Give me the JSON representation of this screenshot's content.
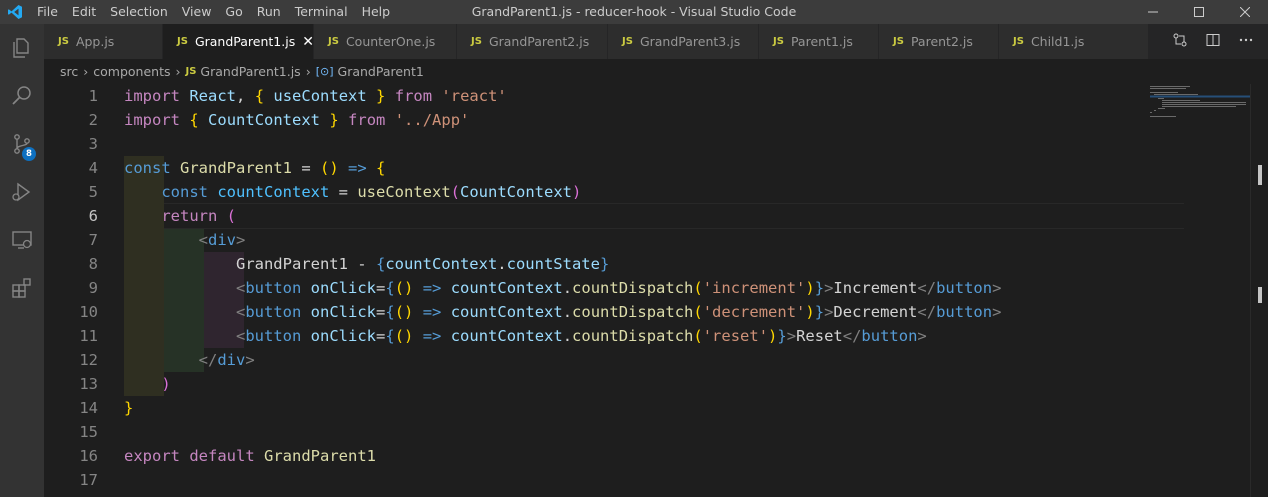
{
  "titlebar": {
    "title": "GrandParent1.js - reducer-hook - Visual Studio Code",
    "menu": [
      "File",
      "Edit",
      "Selection",
      "View",
      "Go",
      "Run",
      "Terminal",
      "Help"
    ]
  },
  "activity": {
    "icons": [
      "explorer-icon",
      "search-icon",
      "source-control-icon",
      "run-debug-icon",
      "remote-explorer-icon",
      "extensions-icon"
    ],
    "scm_badge": "8"
  },
  "tabs": [
    {
      "badge": "JS",
      "label": "App.js",
      "active": false
    },
    {
      "badge": "JS",
      "label": "GrandParent1.js",
      "active": true
    },
    {
      "badge": "JS",
      "label": "CounterOne.js",
      "active": false
    },
    {
      "badge": "JS",
      "label": "GrandParent2.js",
      "active": false
    },
    {
      "badge": "JS",
      "label": "GrandParent3.js",
      "active": false
    },
    {
      "badge": "JS",
      "label": "Parent1.js",
      "active": false
    },
    {
      "badge": "JS",
      "label": "Parent2.js",
      "active": false
    },
    {
      "badge": "JS",
      "label": "Child1.js",
      "active": false
    }
  ],
  "breadcrumb": {
    "folder1": "src",
    "folder2": "components",
    "file_badge": "JS",
    "file": "GrandParent1.js",
    "symbol": "GrandParent1"
  },
  "editor": {
    "line_numbers": [
      "1",
      "2",
      "3",
      "4",
      "5",
      "6",
      "7",
      "8",
      "9",
      "10",
      "11",
      "12",
      "13",
      "14",
      "15",
      "16",
      "17"
    ],
    "current_line": "6",
    "lines": [
      "import React, { useContext } from 'react'",
      "import { CountContext } from '../App'",
      "",
      "const GrandParent1 = () => {",
      "    const countContext = useContext(CountContext)",
      "    return (",
      "        <div>",
      "            GrandParent1 - {countContext.countState}",
      "            <button onClick={() => countContext.countDispatch('increment')}>Increment</button>",
      "            <button onClick={() => countContext.countDispatch('decrement')}>Decrement</button>",
      "            <button onClick={() => countContext.countDispatch('reset')}>Reset</button>",
      "        </div>",
      "    )",
      "}",
      "",
      "export default GrandParent1",
      ""
    ]
  },
  "colors": {
    "accent": "#0e70c0",
    "js_badge": "#cbcb41",
    "keyword": "#569cd6",
    "control": "#c586c0",
    "string": "#ce9178",
    "function": "#dcdcaa",
    "variable": "#9cdcfe"
  }
}
